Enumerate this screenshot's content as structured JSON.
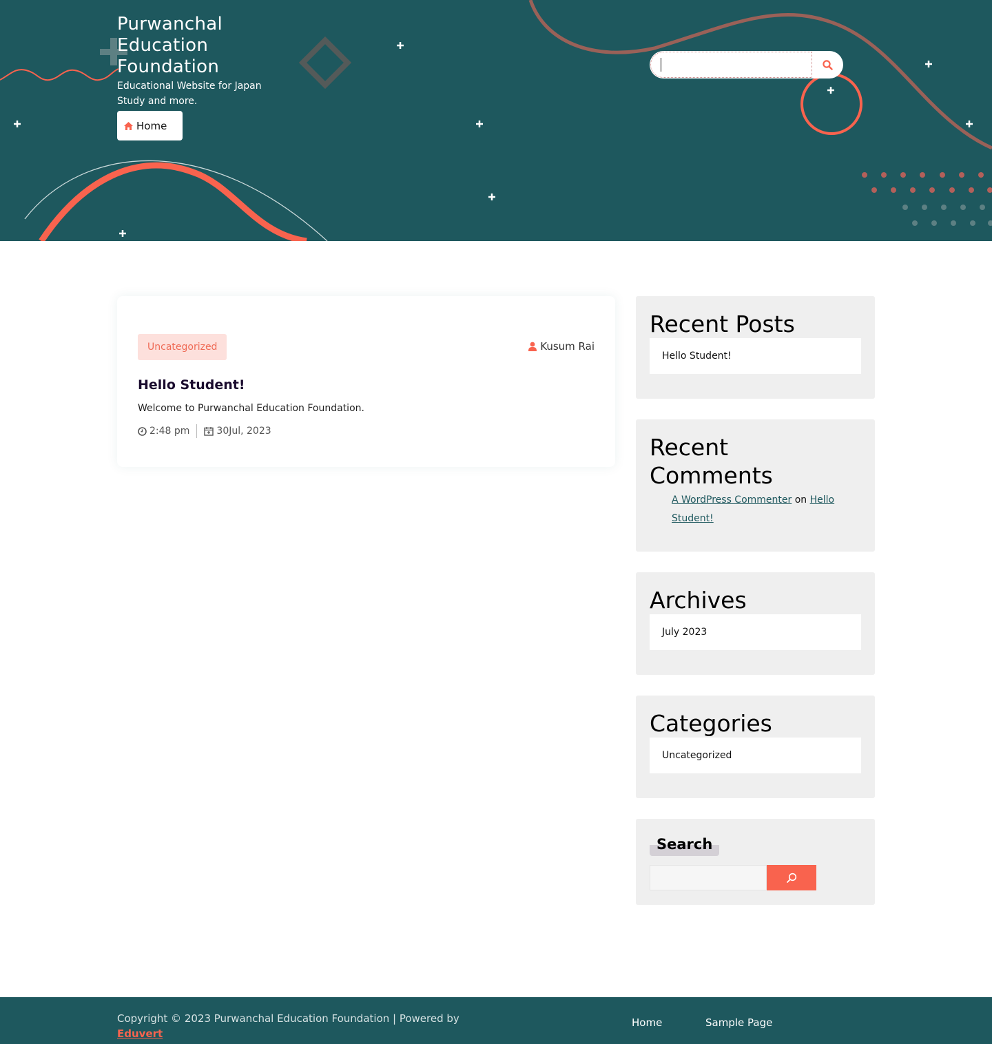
{
  "site": {
    "title": "Purwanchal Education Foundation",
    "description": "Educational Website for Japan Study and more.",
    "nav_home": "Home"
  },
  "header_search": {
    "value": "",
    "placeholder": "",
    "button_icon": "search-icon"
  },
  "post": {
    "category": "Uncategorized",
    "author": "Kusum Rai",
    "title": "Hello Student!",
    "excerpt": "Welcome to Purwanchal Education Foundation.",
    "time": "2:48 pm",
    "date": "30Jul, 2023"
  },
  "sidebar": {
    "recent_posts": {
      "title": "Recent Posts",
      "items": [
        "Hello Student!"
      ]
    },
    "recent_comments": {
      "title": "Recent Comments",
      "author": "A WordPress Commenter",
      "on": "on",
      "post": "Hello Student!"
    },
    "archives": {
      "title": "Archives",
      "items": [
        "July 2023"
      ]
    },
    "categories": {
      "title": "Categories",
      "items": [
        "Uncategorized"
      ]
    },
    "search": {
      "title": "Search",
      "value": "",
      "button_icon": "search-icon"
    }
  },
  "footer": {
    "copyright": "Copyright © 2023 Purwanchal Education Foundation | Powered by",
    "powered_link": "Eduvert",
    "nav": [
      "Home",
      "Sample Page"
    ]
  },
  "colors": {
    "header_bg": "#1e585e",
    "accent": "#f9634e",
    "widget_bg": "#efefef",
    "badge_bg": "#fde0dc"
  }
}
